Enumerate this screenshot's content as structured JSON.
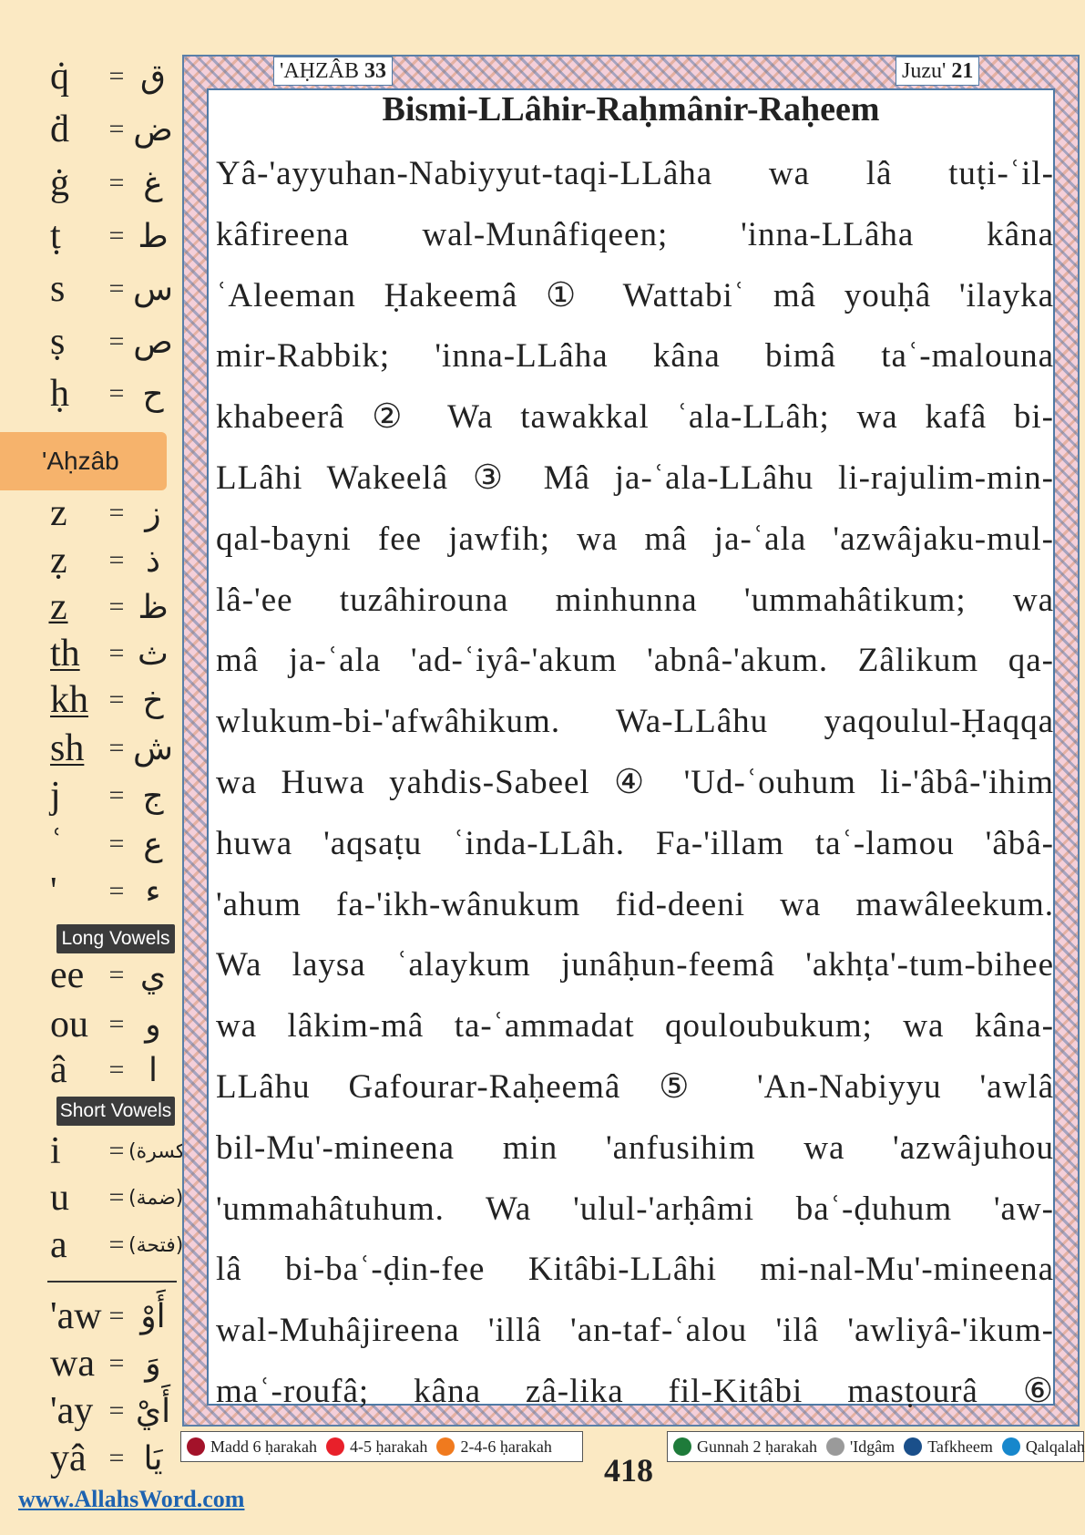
{
  "sidebar": {
    "mappings_top": [
      {
        "latin": "q̇",
        "arabic": "ق",
        "underline": false
      },
      {
        "latin": "ḋ",
        "arabic": "ض",
        "underline": false
      },
      {
        "latin": "ġ",
        "arabic": "غ",
        "underline": false
      },
      {
        "latin": "ṭ",
        "arabic": "ط",
        "underline": false
      },
      {
        "latin": "s",
        "arabic": "س",
        "underline": false
      },
      {
        "latin": "ṣ",
        "arabic": "ص",
        "underline": false
      },
      {
        "latin": "ḥ",
        "arabic": "ح",
        "underline": false
      }
    ],
    "surah_name": "'Aḥzâb",
    "mappings_mid": [
      {
        "latin": "z",
        "arabic": "ز",
        "underline": false
      },
      {
        "latin": "ẓ",
        "arabic": "ذ",
        "underline": false
      },
      {
        "latin": "z̲",
        "arabic": "ظ",
        "underline": false
      },
      {
        "latin": "th",
        "arabic": "ث",
        "underline": true
      },
      {
        "latin": "kh",
        "arabic": "خ",
        "underline": true
      },
      {
        "latin": "sh",
        "arabic": "ش",
        "underline": true
      },
      {
        "latin": "j",
        "arabic": "ج",
        "underline": false
      },
      {
        "latin": "ʿ",
        "arabic": "ع",
        "underline": false
      },
      {
        "latin": "'",
        "arabic": "ء",
        "underline": false
      }
    ],
    "long_vowels_label": "Long Vowels",
    "long_vowels": [
      {
        "latin": "ee",
        "arabic": "ي"
      },
      {
        "latin": "ou",
        "arabic": "و"
      },
      {
        "latin": "â",
        "arabic": "ا"
      }
    ],
    "short_vowels_label": "Short Vowels",
    "short_vowels": [
      {
        "latin": "i",
        "arabic": "(كسرة)"
      },
      {
        "latin": "u",
        "arabic": "(ضمة)"
      },
      {
        "latin": "a",
        "arabic": "(فتحة)"
      }
    ],
    "diphthongs": [
      {
        "latin": "'aw",
        "arabic": "أَوْ"
      },
      {
        "latin": "wa",
        "arabic": "وَ"
      },
      {
        "latin": "'ay",
        "arabic": "أَيْ"
      },
      {
        "latin": "yâ",
        "arabic": "يَا"
      }
    ],
    "website": "www.AllahsWord.com"
  },
  "header": {
    "surah_label": "'AḤZÂB",
    "surah_number": "33",
    "juzu_label": "Juzu'",
    "juzu_number": "21"
  },
  "basmala": "Bismi-LLâhir-Raḥmânir-Raḥeem",
  "verse_lines": [
    "Yâ-'ayyuhan-Nabiyyut-taqi-LLâha wa lâ tuṭi-ʿil-",
    "kâfireena wal-Munâfiqeen; 'inna-LLâha kâna",
    "ʿAleeman Ḥakeemâ ① Wattabiʿ mâ youḥâ 'ilayka",
    "mir-Rabbik; 'inna-LLâha kâna bimâ taʿ-malouna",
    "khabeerâ ② Wa tawakkal ʿala-LLâh; wa kafâ bi-",
    "LLâhi Wakeelâ ③ Mâ ja-ʿala-LLâhu li-rajulim-min-",
    "qal-bayni fee jawfih; wa mâ ja-ʿala 'azwâjaku-mul-",
    "lâ-'ee tuzâhirouna minhunna 'ummahâtikum; wa",
    "mâ ja-ʿala 'ad-ʿiyâ-'akum 'abnâ-'akum. Zâlikum qa-",
    "wlukum-bi-'afwâhikum. Wa-LLâhu yaqoulul-Ḥaqqa",
    "wa Huwa yahdis-Sabeel ④ 'Ud-ʿouhum li-'âbâ-'ihim",
    "huwa 'aqsaṭu ʿinda-LLâh. Fa-'illam taʿ-lamou 'âbâ-",
    "'ahum fa-'ikh-wânukum fid-deeni wa mawâleekum.",
    "Wa laysa ʿalaykum junâḥun-feemâ 'akhṭa'-tum-bihee",
    "wa lâkim-mâ ta-ʿammadat qouloubukum; wa kâna-",
    "LLâhu Gafourar-Raḥeemâ ⑤ 'An-Nabiyyu 'awlâ",
    "bil-Mu'-mineena min 'anfusihim wa 'azwâjuhou",
    "'ummahâtuhum. Wa 'ulul-'arḥâmi baʿ-ḍuhum 'aw-",
    "lâ bi-baʿ-ḍin-fee Kitâbi-LLâhi mi-nal-Mu'-mineena",
    "wal-Muhâjireena 'illâ 'an-taf-ʿalou 'ilâ 'awliyâ-'ikum-",
    "maʿ-roufâ; kâna zâ-lika fil-Kitâbi masṭourâ ⑥"
  ],
  "verse_numbers": [
    "1",
    "2",
    "3",
    "4",
    "5",
    "6"
  ],
  "legend_left": [
    {
      "color": "#a3122a",
      "label": "Madd 6 ḥarakah"
    },
    {
      "color": "#e8202a",
      "label": "4-5 ḥarakah"
    },
    {
      "color": "#f07a1e",
      "label": "2-4-6 ḥarakah"
    }
  ],
  "legend_right": [
    {
      "color": "#1e7b3a",
      "label": "Gunnah 2 ḥarakah"
    },
    {
      "color": "#9a9a9a",
      "label": "'Idgâm"
    },
    {
      "color": "#1a4f8a",
      "label": "Tafkheem"
    },
    {
      "color": "#1787cc",
      "label": "Qalqalah"
    }
  ],
  "page_number": "418"
}
